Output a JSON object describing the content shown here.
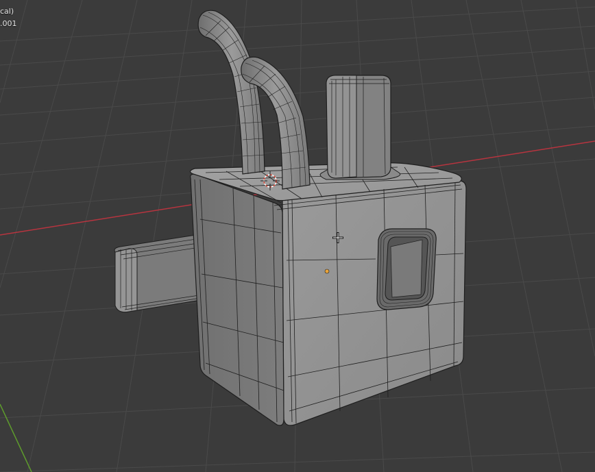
{
  "viewport": {
    "overlay_line_1": "cal)",
    "overlay_line_2": ".001"
  },
  "colors": {
    "background": "#3b3b3b",
    "grid": "#4a4a4a",
    "x_axis": "#b8343f",
    "y_axis": "#5e9c2c",
    "mesh_fill": "#8a8a8a",
    "mesh_shadow": "#6c6c6c",
    "wire": "#1e1e1e",
    "origin": "#e8a33a"
  }
}
